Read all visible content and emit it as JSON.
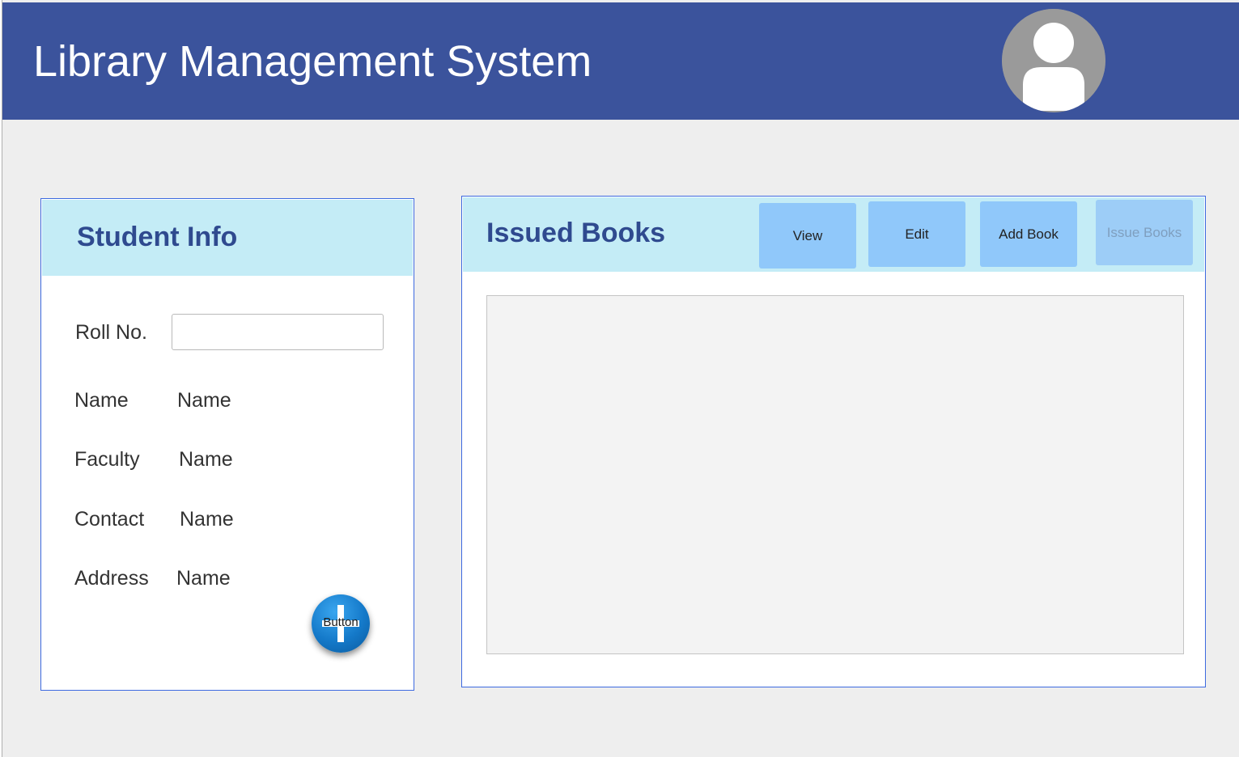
{
  "header": {
    "title": "Library Management System"
  },
  "student_info": {
    "title": "Student Info",
    "roll_label": "Roll No.",
    "roll_value": "",
    "fields": [
      {
        "label": "Name",
        "value": "Name"
      },
      {
        "label": "Faculty",
        "value": "Name"
      },
      {
        "label": "Contact",
        "value": "Name"
      },
      {
        "label": "Address",
        "value": "Name"
      }
    ],
    "add_button_label": "Button"
  },
  "issued_books": {
    "title": "Issued Books",
    "buttons": {
      "view": "View",
      "edit": "Edit",
      "add_book": "Add Book",
      "issue_books": "Issue Books"
    }
  },
  "colors": {
    "header_bg": "#3b539c",
    "panel_header_bg": "#c4ecf6",
    "panel_title": "#2f4a8f",
    "panel_border": "#3d6ae0",
    "tool_button_bg": "#90c8fa"
  },
  "icons": {
    "avatar": "user-avatar-icon",
    "add": "plus-icon"
  }
}
